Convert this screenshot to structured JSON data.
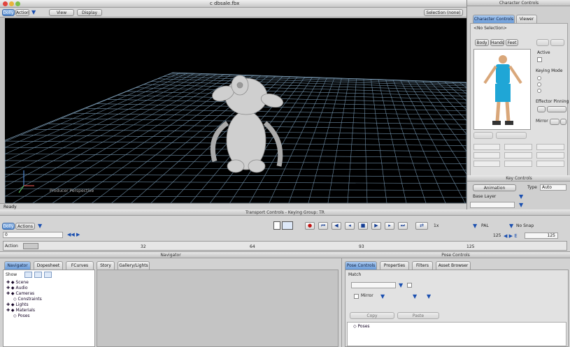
{
  "window": {
    "title": "c dbsale.fbx"
  },
  "toolbar": {
    "items": [
      "Dolly",
      "Actions",
      "View",
      "Display"
    ],
    "selection_label": "Selection (none)"
  },
  "viewport": {
    "perspective_label": "Producer Perspective",
    "status": "Ready"
  },
  "character_panel": {
    "header": "Character Controls",
    "tabs": [
      "Character Controls",
      "Viewer"
    ],
    "selection": "<No Selection>",
    "mode_buttons": [
      "Body",
      "Hands",
      "Feet",
      "",
      ""
    ],
    "active_label": "Active",
    "keying_mode_label": "Keying Mode",
    "keying_options": [
      "",
      "",
      ""
    ],
    "effector_pinning_label": "Effector Pinning",
    "mirror_label": "Mirror",
    "key_controls_header": "Key Controls",
    "animation_button": "Animation",
    "type_label": "Type",
    "type_value": "Auto",
    "base_layer_label": "Base Layer"
  },
  "transport": {
    "header": "Transport Controls  -  Keying Group: TR",
    "mode": "Actions",
    "mode_prefix": "Dolly",
    "frame_value": "0",
    "end_frame": "125",
    "end_frame2": "125",
    "fps": "PAL",
    "snap": "No Snap",
    "timeline_label": "Action",
    "ticks": [
      "32",
      "64",
      "93",
      "125"
    ],
    "speed": "1x"
  },
  "navigator": {
    "header": "Navigator",
    "tabs": [
      "Navigator",
      "Dopesheet",
      "FCurves",
      "Story",
      "Gallery/Lights"
    ],
    "show_label": "Show",
    "tree": [
      "Scene",
      "Audio",
      "Cameras",
      "Constraints",
      "Lights",
      "Materials",
      "Poses"
    ]
  },
  "pose_panel": {
    "header": "Pose Controls",
    "tabs": [
      "Pose Controls",
      "Properties",
      "Filters",
      "Asset Browser"
    ],
    "match_label": "Match",
    "mirror_label": "Mirror",
    "buttons": [
      "Copy",
      "Paste"
    ],
    "pose_item": "Poses"
  },
  "colors": {
    "accent": "#4f86cc",
    "viewport_bg": "#000000",
    "grid": "#6f8fa8"
  }
}
